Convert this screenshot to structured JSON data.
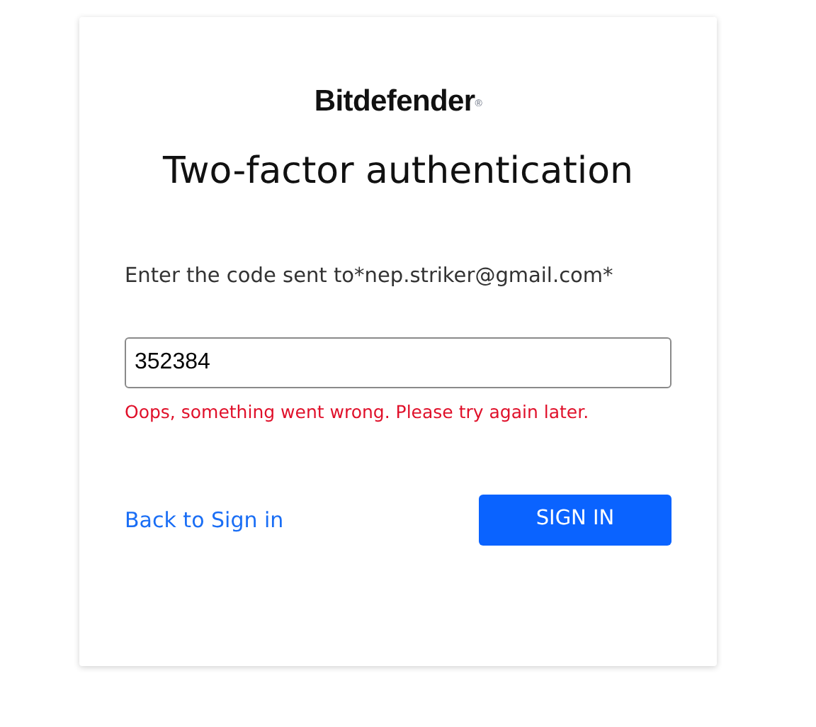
{
  "logo": "Bitdefender$^{®}$",
  "title": "Two-factor authentication",
  "instruction": "Enter the code sent to*nep.striker@gmail.com*",
  "code_field": {
    "value": "352384"
  },
  "error": "Oops, something went wrong. Please try again later.",
  "back_link": "Back to Sign in",
  "submit_button": "SIGN IN"
}
